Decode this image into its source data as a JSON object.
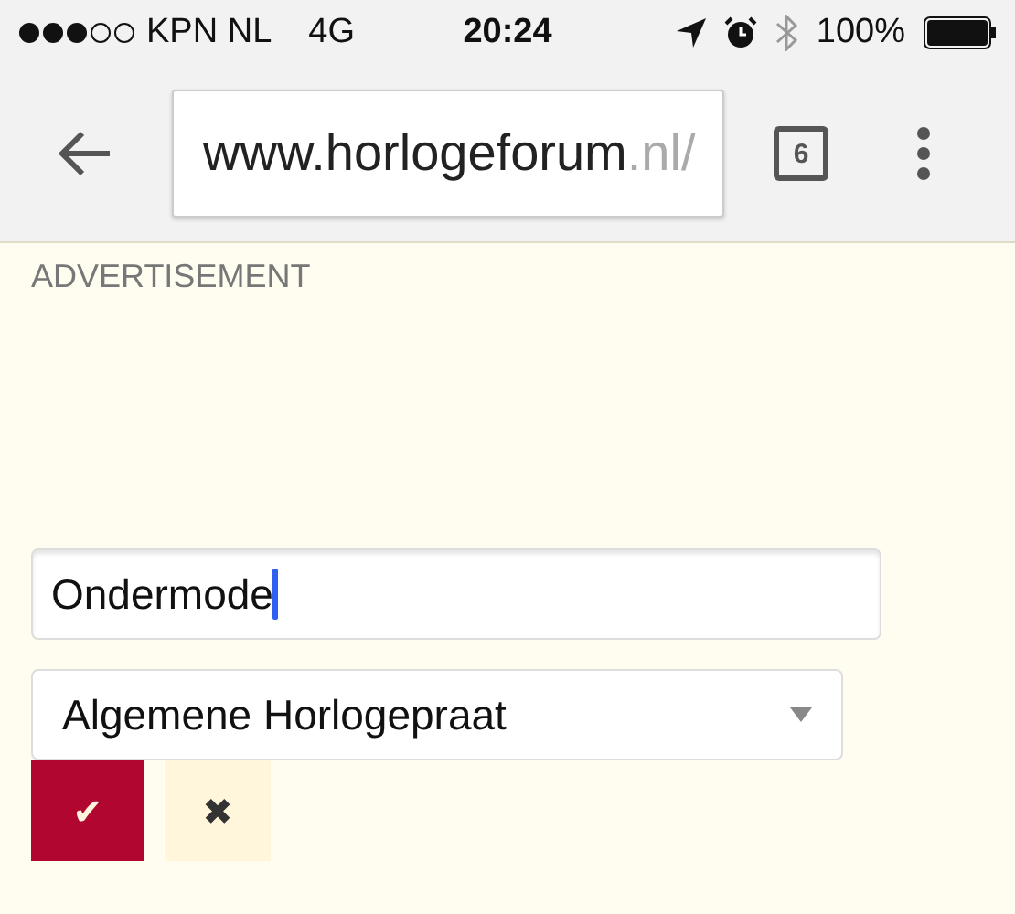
{
  "status_bar": {
    "carrier": "KPN NL",
    "network": "4G",
    "time": "20:24",
    "battery": "100%"
  },
  "toolbar": {
    "url": {
      "main": "www.horlogeforum",
      "faded": ".nl/"
    },
    "tab_count": "6"
  },
  "page": {
    "ad_label": "ADVERTISEMENT",
    "title_field": {
      "value": "Ondermode"
    },
    "forum_select": {
      "value": "Algemene Horlogepraat"
    },
    "buttons": [
      {
        "kind": "confirm",
        "label": "✔"
      },
      {
        "kind": "cancel",
        "label": "✖"
      }
    ]
  }
}
